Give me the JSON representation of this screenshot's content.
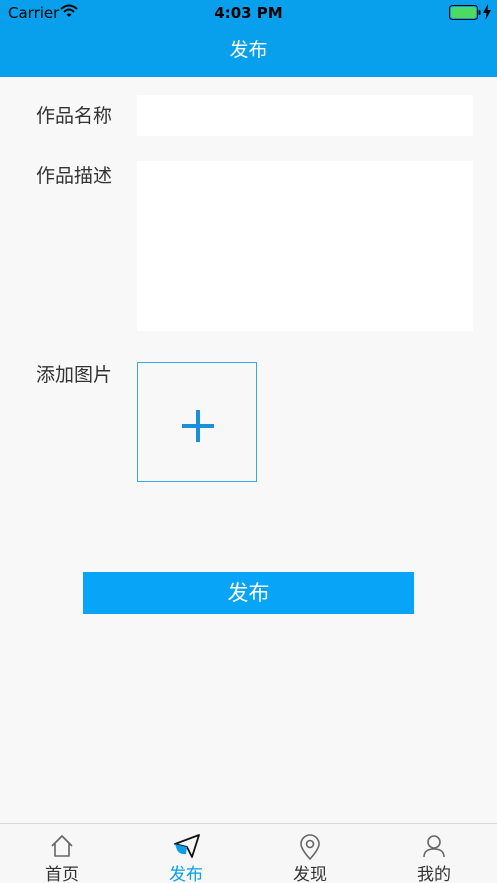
{
  "status_bar": {
    "carrier": "Carrier",
    "time": "4:03 PM",
    "icons": [
      "wifi-icon",
      "battery-icon",
      "charging-icon"
    ]
  },
  "nav": {
    "title": "发布"
  },
  "form": {
    "name_label": "作品名称",
    "name_value": "",
    "description_label": "作品描述",
    "description_value": "",
    "image_label": "添加图片",
    "add_icon": "plus-icon"
  },
  "publish_button": "发布",
  "tabs": [
    {
      "label": "首页",
      "icon": "home-icon",
      "active": false
    },
    {
      "label": "发布",
      "icon": "paper-plane-icon",
      "active": true
    },
    {
      "label": "发现",
      "icon": "location-pin-icon",
      "active": false
    },
    {
      "label": "我的",
      "icon": "user-icon",
      "active": false
    }
  ],
  "colors": {
    "accent": "#08a0ec",
    "button": "#08a4f8",
    "active_tab": "#0aa0e6",
    "background": "#f8f8f8",
    "battery": "#4cd964"
  }
}
